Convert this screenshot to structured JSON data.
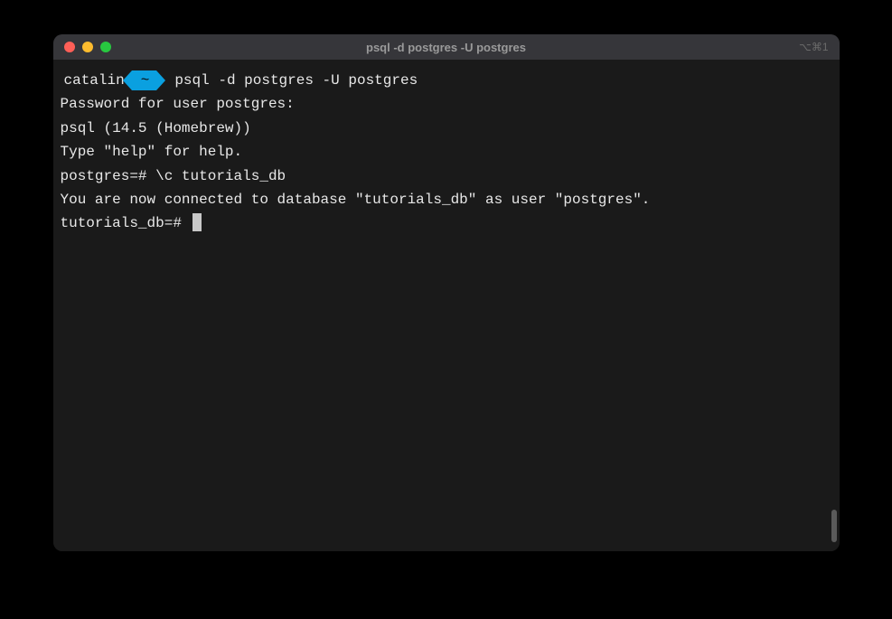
{
  "window": {
    "title": "psql -d postgres -U postgres",
    "shortcut": "⌥⌘1"
  },
  "prompt": {
    "user": "catalin",
    "dir": "~",
    "command": "psql -d postgres -U postgres"
  },
  "output": {
    "line1": "Password for user postgres:",
    "line2": "psql (14.5 (Homebrew))",
    "line3": "Type \"help\" for help.",
    "line4": "",
    "line5": "postgres=# \\c tutorials_db",
    "line6": "You are now connected to database \"tutorials_db\" as user \"postgres\".",
    "line7": "tutorials_db=# "
  }
}
